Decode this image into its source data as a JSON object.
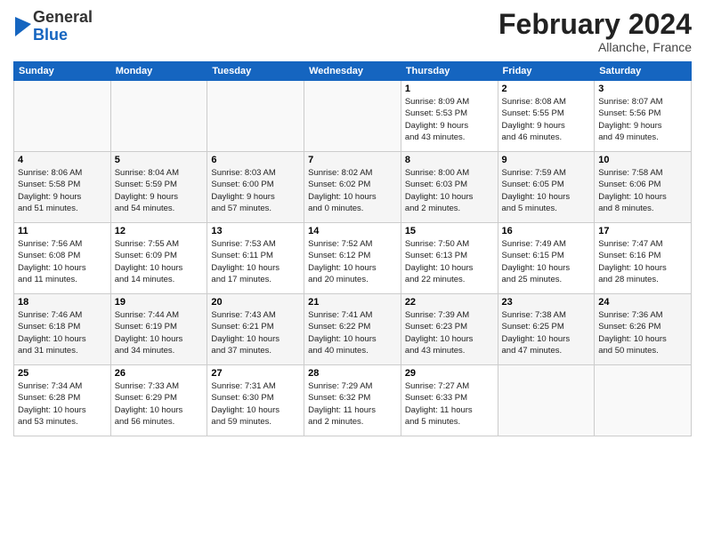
{
  "logo": {
    "general": "General",
    "blue": "Blue"
  },
  "title": {
    "month": "February 2024",
    "location": "Allanche, France"
  },
  "weekdays": [
    "Sunday",
    "Monday",
    "Tuesday",
    "Wednesday",
    "Thursday",
    "Friday",
    "Saturday"
  ],
  "weeks": [
    [
      {
        "day": "",
        "info": ""
      },
      {
        "day": "",
        "info": ""
      },
      {
        "day": "",
        "info": ""
      },
      {
        "day": "",
        "info": ""
      },
      {
        "day": "1",
        "info": "Sunrise: 8:09 AM\nSunset: 5:53 PM\nDaylight: 9 hours\nand 43 minutes."
      },
      {
        "day": "2",
        "info": "Sunrise: 8:08 AM\nSunset: 5:55 PM\nDaylight: 9 hours\nand 46 minutes."
      },
      {
        "day": "3",
        "info": "Sunrise: 8:07 AM\nSunset: 5:56 PM\nDaylight: 9 hours\nand 49 minutes."
      }
    ],
    [
      {
        "day": "4",
        "info": "Sunrise: 8:06 AM\nSunset: 5:58 PM\nDaylight: 9 hours\nand 51 minutes."
      },
      {
        "day": "5",
        "info": "Sunrise: 8:04 AM\nSunset: 5:59 PM\nDaylight: 9 hours\nand 54 minutes."
      },
      {
        "day": "6",
        "info": "Sunrise: 8:03 AM\nSunset: 6:00 PM\nDaylight: 9 hours\nand 57 minutes."
      },
      {
        "day": "7",
        "info": "Sunrise: 8:02 AM\nSunset: 6:02 PM\nDaylight: 10 hours\nand 0 minutes."
      },
      {
        "day": "8",
        "info": "Sunrise: 8:00 AM\nSunset: 6:03 PM\nDaylight: 10 hours\nand 2 minutes."
      },
      {
        "day": "9",
        "info": "Sunrise: 7:59 AM\nSunset: 6:05 PM\nDaylight: 10 hours\nand 5 minutes."
      },
      {
        "day": "10",
        "info": "Sunrise: 7:58 AM\nSunset: 6:06 PM\nDaylight: 10 hours\nand 8 minutes."
      }
    ],
    [
      {
        "day": "11",
        "info": "Sunrise: 7:56 AM\nSunset: 6:08 PM\nDaylight: 10 hours\nand 11 minutes."
      },
      {
        "day": "12",
        "info": "Sunrise: 7:55 AM\nSunset: 6:09 PM\nDaylight: 10 hours\nand 14 minutes."
      },
      {
        "day": "13",
        "info": "Sunrise: 7:53 AM\nSunset: 6:11 PM\nDaylight: 10 hours\nand 17 minutes."
      },
      {
        "day": "14",
        "info": "Sunrise: 7:52 AM\nSunset: 6:12 PM\nDaylight: 10 hours\nand 20 minutes."
      },
      {
        "day": "15",
        "info": "Sunrise: 7:50 AM\nSunset: 6:13 PM\nDaylight: 10 hours\nand 22 minutes."
      },
      {
        "day": "16",
        "info": "Sunrise: 7:49 AM\nSunset: 6:15 PM\nDaylight: 10 hours\nand 25 minutes."
      },
      {
        "day": "17",
        "info": "Sunrise: 7:47 AM\nSunset: 6:16 PM\nDaylight: 10 hours\nand 28 minutes."
      }
    ],
    [
      {
        "day": "18",
        "info": "Sunrise: 7:46 AM\nSunset: 6:18 PM\nDaylight: 10 hours\nand 31 minutes."
      },
      {
        "day": "19",
        "info": "Sunrise: 7:44 AM\nSunset: 6:19 PM\nDaylight: 10 hours\nand 34 minutes."
      },
      {
        "day": "20",
        "info": "Sunrise: 7:43 AM\nSunset: 6:21 PM\nDaylight: 10 hours\nand 37 minutes."
      },
      {
        "day": "21",
        "info": "Sunrise: 7:41 AM\nSunset: 6:22 PM\nDaylight: 10 hours\nand 40 minutes."
      },
      {
        "day": "22",
        "info": "Sunrise: 7:39 AM\nSunset: 6:23 PM\nDaylight: 10 hours\nand 43 minutes."
      },
      {
        "day": "23",
        "info": "Sunrise: 7:38 AM\nSunset: 6:25 PM\nDaylight: 10 hours\nand 47 minutes."
      },
      {
        "day": "24",
        "info": "Sunrise: 7:36 AM\nSunset: 6:26 PM\nDaylight: 10 hours\nand 50 minutes."
      }
    ],
    [
      {
        "day": "25",
        "info": "Sunrise: 7:34 AM\nSunset: 6:28 PM\nDaylight: 10 hours\nand 53 minutes."
      },
      {
        "day": "26",
        "info": "Sunrise: 7:33 AM\nSunset: 6:29 PM\nDaylight: 10 hours\nand 56 minutes."
      },
      {
        "day": "27",
        "info": "Sunrise: 7:31 AM\nSunset: 6:30 PM\nDaylight: 10 hours\nand 59 minutes."
      },
      {
        "day": "28",
        "info": "Sunrise: 7:29 AM\nSunset: 6:32 PM\nDaylight: 11 hours\nand 2 minutes."
      },
      {
        "day": "29",
        "info": "Sunrise: 7:27 AM\nSunset: 6:33 PM\nDaylight: 11 hours\nand 5 minutes."
      },
      {
        "day": "",
        "info": ""
      },
      {
        "day": "",
        "info": ""
      }
    ]
  ]
}
